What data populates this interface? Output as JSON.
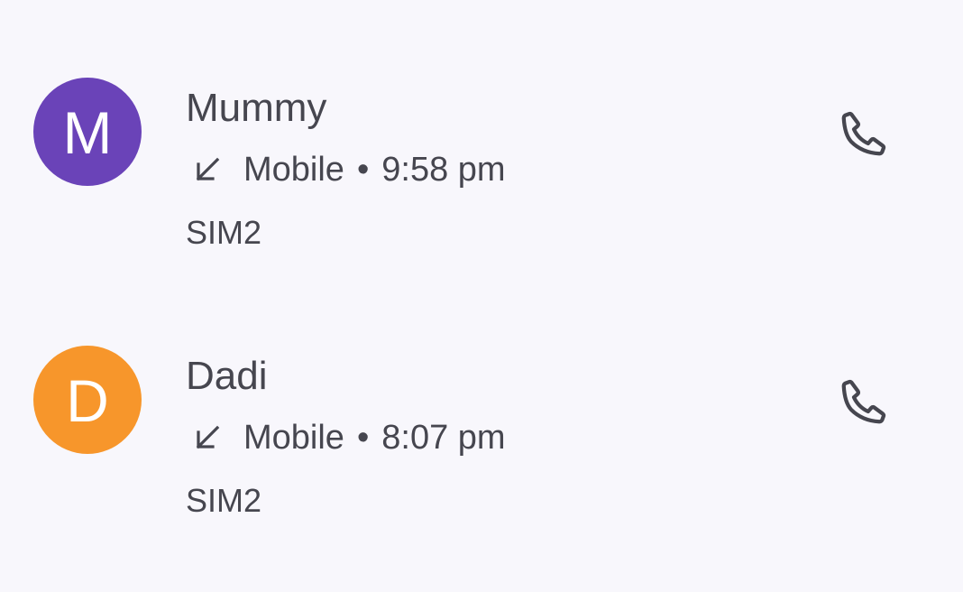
{
  "calls": [
    {
      "name": "Mummy",
      "avatar_letter": "M",
      "avatar_color": "#6a43b8",
      "call_type_icon": "incoming-call-arrow-icon",
      "number_type": "Mobile",
      "separator": "•",
      "time": "9:58 pm",
      "sim": "SIM2",
      "action_icon": "phone-icon"
    },
    {
      "name": "Dadi",
      "avatar_letter": "D",
      "avatar_color": "#f7962b",
      "call_type_icon": "incoming-call-arrow-icon",
      "number_type": "Mobile",
      "separator": "•",
      "time": "8:07 pm",
      "sim": "SIM2",
      "action_icon": "phone-icon"
    }
  ],
  "colors": {
    "background": "#f8f7fc",
    "text": "#46464f"
  }
}
